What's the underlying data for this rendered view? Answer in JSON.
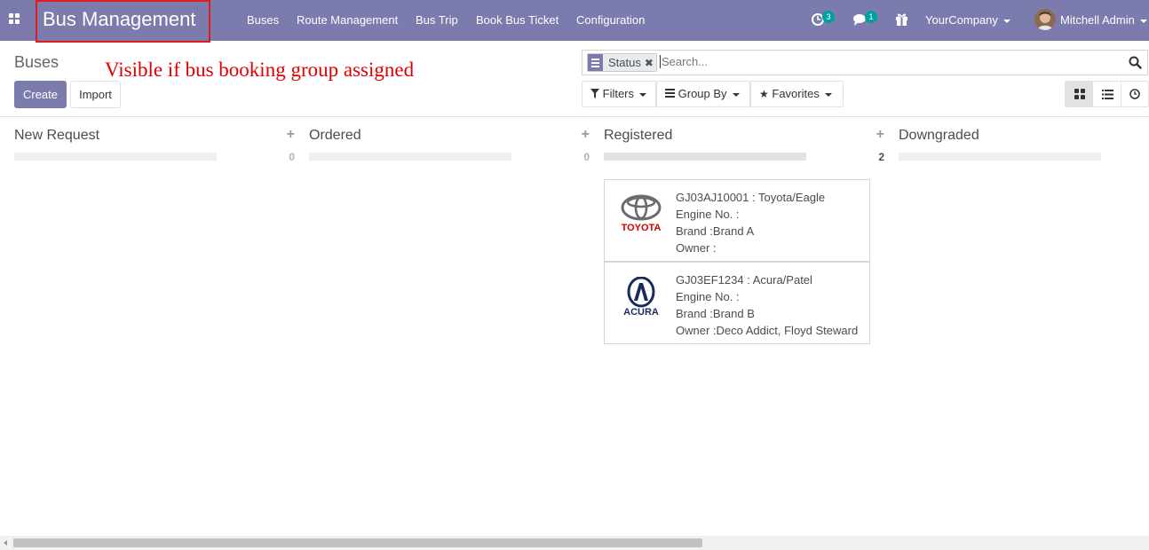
{
  "navbar": {
    "brand": "Bus Management",
    "menu": [
      "Buses",
      "Route Management",
      "Bus Trip",
      "Book Bus Ticket",
      "Configuration"
    ],
    "activity_count": "3",
    "messages_count": "1",
    "company": "YourCompany",
    "user": "Mitchell Admin",
    "color": "#7c7bad"
  },
  "annotation": "Visible if bus booking group assigned",
  "control_panel": {
    "title": "Buses",
    "create_label": "Create",
    "import_label": "Import",
    "search": {
      "facet_label": "Status",
      "placeholder": "Search..."
    },
    "filters_label": "Filters",
    "group_by_label": "Group By",
    "favorites_label": "Favorites",
    "views": [
      "kanban-icon",
      "list-icon",
      "activity-clock-icon"
    ],
    "active_view": "kanban"
  },
  "kanban": {
    "columns": [
      {
        "title": "New Request",
        "count": "0",
        "cards": []
      },
      {
        "title": "Ordered",
        "count": "0",
        "cards": []
      },
      {
        "title": "Registered",
        "count": "2",
        "cards": [
          {
            "logo": "TOYOTA",
            "line1": "GJ03AJ10001 : Toyota/Eagle",
            "line2": "Engine No. :",
            "line3": "Brand :Brand A",
            "line4": "Owner :"
          },
          {
            "logo": "ACURA",
            "line1": "GJ03EF1234 : Acura/Patel",
            "line2": "Engine No. :",
            "line3": "Brand :Brand B",
            "line4": "Owner :Deco Addict, Floyd Steward"
          }
        ]
      },
      {
        "title": "Downgraded",
        "count": "",
        "cards": []
      }
    ]
  },
  "colors": {
    "accent": "#7c7bad",
    "badge": "#00a09d",
    "annotation": "#e00000",
    "toyota_red": "#d40000",
    "acura_navy": "#1a2a5c"
  }
}
